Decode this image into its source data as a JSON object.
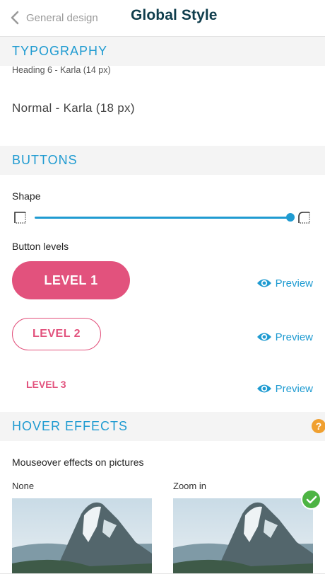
{
  "header": {
    "back_label": "General design",
    "title": "Global Style"
  },
  "typography": {
    "section_title": "TYPOGRAPHY",
    "heading6_sample": "Heading 6 - Karla (14 px)",
    "normal_sample": "Normal - Karla (18 px)"
  },
  "buttons": {
    "section_title": "BUTTONS",
    "shape_label": "Shape",
    "shape_value": 1.0,
    "levels_label": "Button levels",
    "level1_label": "LEVEL 1",
    "level2_label": "LEVEL 2",
    "level3_label": "LEVEL 3",
    "preview_label": "Preview"
  },
  "hover_effects": {
    "section_title": "HOVER EFFECTS",
    "help_symbol": "?",
    "mouseover_label": "Mouseover effects on pictures",
    "options": [
      {
        "label": "None",
        "selected": false
      },
      {
        "label": "Zoom in",
        "selected": true
      }
    ]
  },
  "colors": {
    "accent_blue": "#1f9bd1",
    "brand_pink": "#e2527d",
    "title_dark": "#0f3d4c",
    "help_orange": "#f0a030",
    "check_green": "#4db443"
  },
  "icons": {
    "back": "chevron-left-icon",
    "preview": "eye-icon",
    "help": "question-icon",
    "selected": "check-icon",
    "shape_square": "square-corner-icon",
    "shape_round": "rounded-corner-icon"
  }
}
